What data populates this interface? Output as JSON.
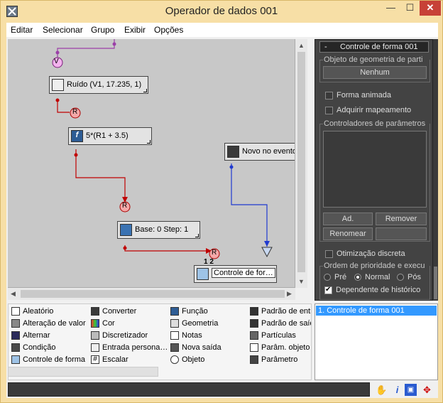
{
  "window": {
    "title": "Operador de dados 001"
  },
  "titlebar_buttons": {
    "minimize": "—",
    "maximize": "☐",
    "close": "✕"
  },
  "menu": [
    "Editar",
    "Selecionar",
    "Grupo",
    "Exibir",
    "Opções"
  ],
  "nodes": {
    "v_port": "V",
    "noise": "Ruído (V1, 17.235, 1)",
    "r1": "R",
    "func_prefix": "f",
    "func": "5*(R1 + 3.5)",
    "event": "Novo no evento",
    "r2": "R",
    "scale": "Base: 0  Step: 1",
    "r3": "R",
    "shape_ports": "1 2",
    "shape": "Controle de for…"
  },
  "right_panel": {
    "rollout_toggle": "-",
    "rollout_title": "Controle de forma 001",
    "geom_group": "Objeto de geometria de parti",
    "none_button": "Nenhum",
    "animated_shape": "Forma animada",
    "acquire_mapping": "Adquirir mapeamento",
    "param_controllers_group": "Controladores de parâmetros",
    "add_button": "Ad.",
    "remove_button": "Remover",
    "rename_button": "Renomear",
    "discrete_opt": "Otimização discreta",
    "priority_group": "Ordem de prioridade e execu",
    "radio_pre": "Pré",
    "radio_normal": "Normal",
    "radio_pos": "Pós",
    "history_dependent": "Dependente de histórico"
  },
  "palette": {
    "col1": [
      "Aleatório",
      "Alteração de valor",
      "Alternar",
      "Condição",
      "Controle de forma"
    ],
    "col2": [
      "Converter",
      "Cor",
      "Discretizador",
      "Entrada persona…",
      "Escalar"
    ],
    "col3": [
      "Função",
      "Geometria",
      "Notas",
      "Nova saída",
      "Objeto"
    ],
    "col4": [
      "Padrão de entr",
      "Padrão de saíd",
      "Partículas",
      "Parâm. objeto",
      "Parâmetro"
    ]
  },
  "event_list": [
    "1. Controle de forma 001"
  ],
  "status_icons": [
    "hand-icon",
    "info-icon",
    "fit-view-icon",
    "move-icon"
  ],
  "colors": {
    "title_bar": "#f7dfa6",
    "close": "#c74137",
    "wire_purple": "#9b3fa8",
    "wire_red": "#c00000",
    "wire_blue": "#1f3ad0",
    "selection": "#3399ff"
  }
}
